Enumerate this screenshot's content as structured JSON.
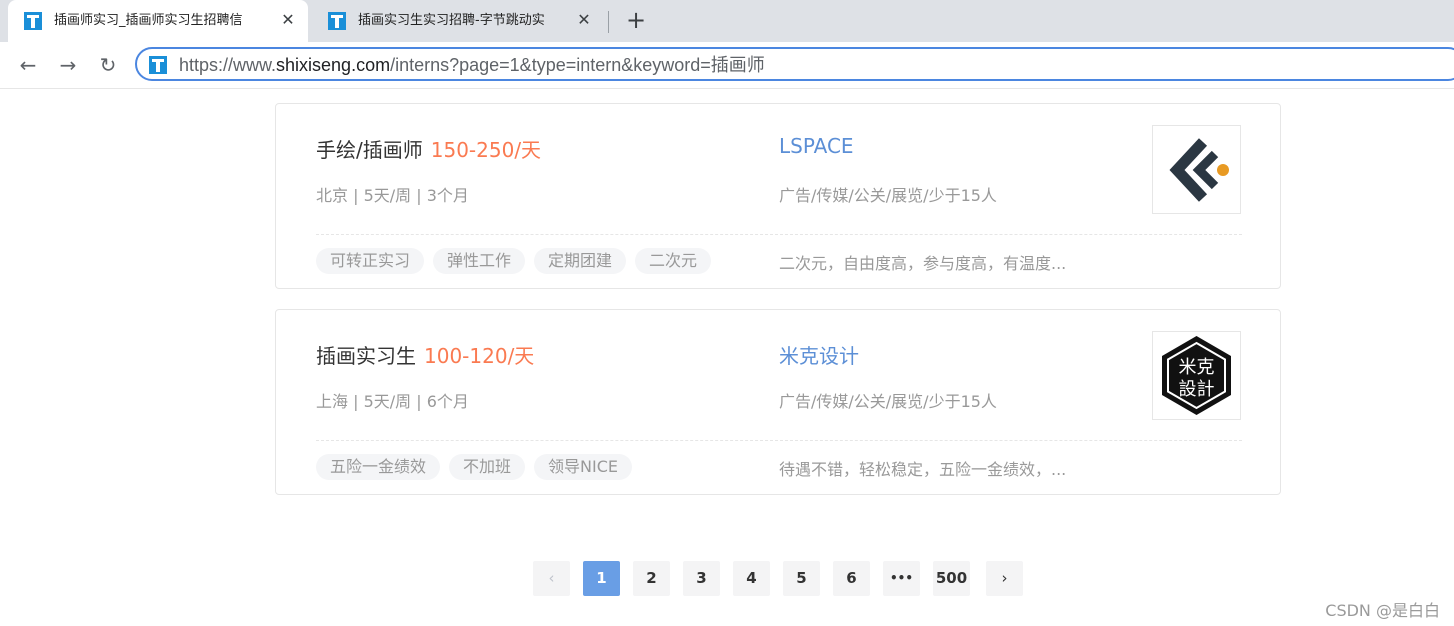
{
  "browser": {
    "tabs": [
      {
        "title": "插画师实习_插画师实习生招聘信",
        "close": "✕",
        "favicon": "shixiseng-favicon"
      },
      {
        "title": "插画实习生实习招聘-字节跳动实",
        "close": "✕",
        "favicon": "shixiseng-favicon"
      }
    ],
    "new_tab": "+",
    "back": "←",
    "forward": "→",
    "reload": "↻",
    "url_prefix": "https://www.",
    "url_domain": "shixiseng.com",
    "url_path": "/interns?page=1&type=intern&keyword=插画师"
  },
  "jobs": [
    {
      "title": "手绘/插画师",
      "salary": "150-250/天",
      "meta": "北京 | 5天/周 | 3个月",
      "company": "LSPACE",
      "industry": "广告/传媒/公关/展览/少于15人",
      "tags": [
        "可转正实习",
        "弹性工作",
        "定期团建",
        "二次元"
      ],
      "description": "二次元，自由度高，参与度高，有温度...",
      "logo": "lspace-logo"
    },
    {
      "title": "插画实习生",
      "salary": "100-120/天",
      "meta": "上海 | 5天/周 | 6个月",
      "company": "米克设计",
      "industry": "广告/传媒/公关/展览/少于15人",
      "tags": [
        "五险一金绩效",
        "不加班",
        "领导NICE"
      ],
      "description": "待遇不错，轻松稳定，五险一金绩效，...",
      "logo": "mike-design-logo",
      "logo_text": [
        "米克",
        "設計"
      ]
    }
  ],
  "pagination": {
    "prev": "‹",
    "next": "›",
    "pages": [
      "1",
      "2",
      "3",
      "4",
      "5",
      "6",
      "•••",
      "500"
    ],
    "current": "1"
  },
  "watermark": "CSDN @是白白",
  "colors": {
    "salary": "#fa7a51",
    "company": "#5c8fd6",
    "active_page": "#699ee5",
    "omnibox_border": "#4b86e0"
  }
}
